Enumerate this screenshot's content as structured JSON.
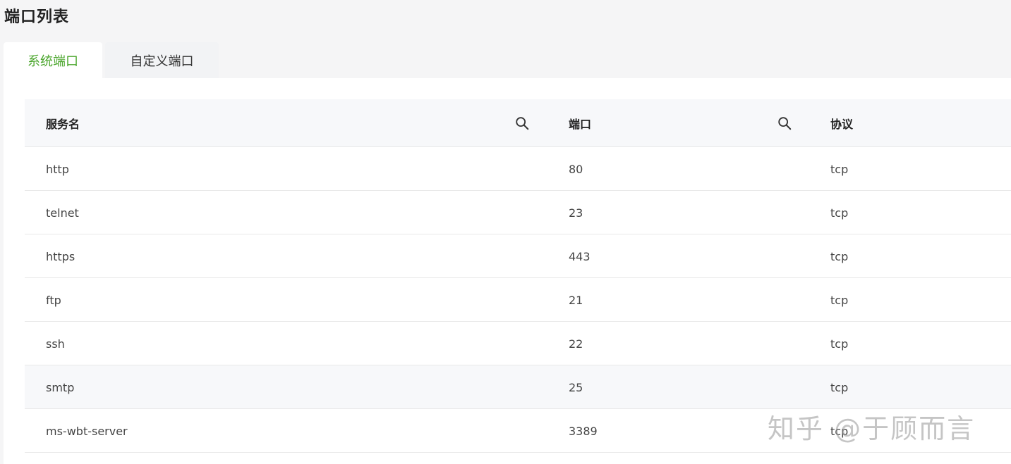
{
  "page": {
    "title": "端口列表"
  },
  "tabs": [
    {
      "label": "系统端口",
      "active": true
    },
    {
      "label": "自定义端口",
      "active": false
    }
  ],
  "table": {
    "columns": [
      {
        "label": "服务名",
        "searchable": true
      },
      {
        "label": "端口",
        "searchable": true
      },
      {
        "label": "协议",
        "searchable": false
      }
    ],
    "rows": [
      {
        "service": "http",
        "port": "80",
        "protocol": "tcp"
      },
      {
        "service": "telnet",
        "port": "23",
        "protocol": "tcp"
      },
      {
        "service": "https",
        "port": "443",
        "protocol": "tcp"
      },
      {
        "service": "ftp",
        "port": "21",
        "protocol": "tcp"
      },
      {
        "service": "ssh",
        "port": "22",
        "protocol": "tcp"
      },
      {
        "service": "smtp",
        "port": "25",
        "protocol": "tcp"
      },
      {
        "service": "ms-wbt-server",
        "port": "3389",
        "protocol": "tcp"
      }
    ]
  },
  "watermark": {
    "text": "知乎 @于顾而言"
  },
  "colors": {
    "accent": "#4ba62d",
    "header_bg": "#f7f8fa",
    "border": "#e8e8e8"
  }
}
